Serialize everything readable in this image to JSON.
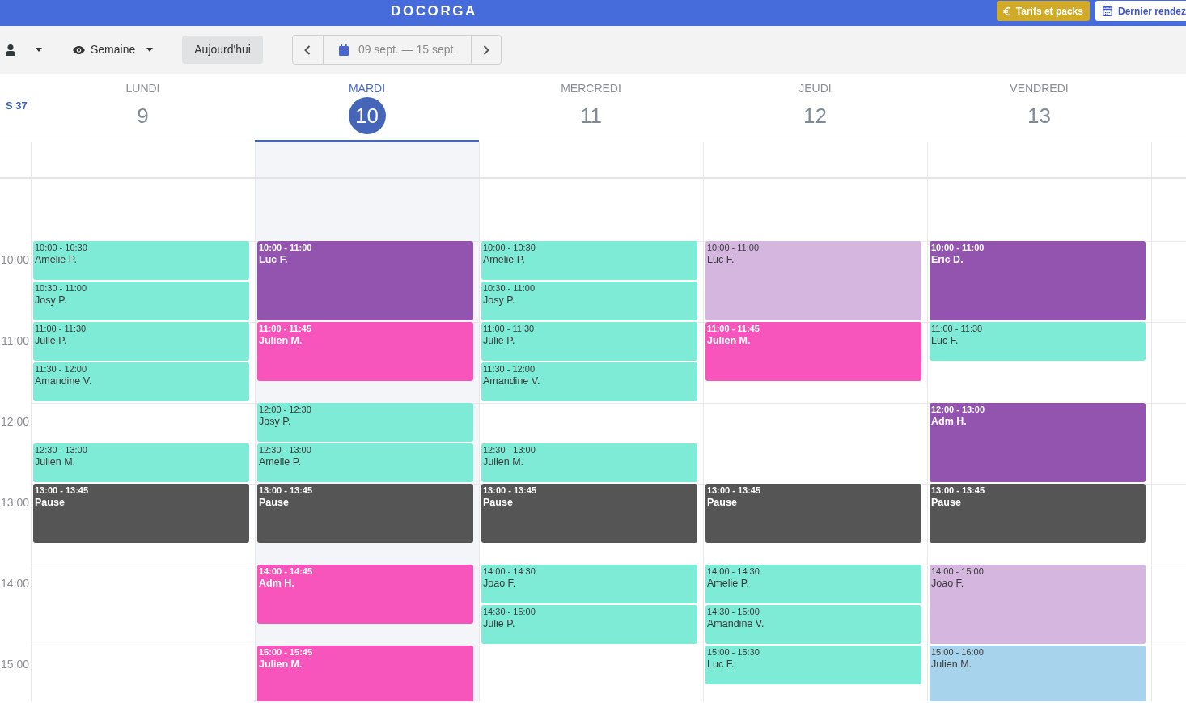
{
  "top_bar": {
    "logo": "DOCORGA",
    "buttons": [
      {
        "kind": "accent",
        "label": "Tarifs et packs"
      },
      {
        "kind": "outline",
        "label": "Dernier rendez"
      }
    ]
  },
  "toolbar": {
    "view": "Semaine",
    "today_button": "Aujourd'hui",
    "date_range": "09 sept. — 15 sept."
  },
  "week_label": "S 37",
  "hours": [
    "10:00",
    "11:00",
    "12:00",
    "13:00",
    "14:00",
    "15:00"
  ],
  "days": [
    {
      "name": "LUNDI",
      "number": "9",
      "selected": false,
      "events": [
        {
          "time": "10:00 - 10:30",
          "title": "Amelie P.",
          "color": "#7eebd6"
        },
        {
          "time": "10:30 - 11:00",
          "title": "Josy P.",
          "color": "#7eebd6"
        },
        {
          "time": "11:00 - 11:30",
          "title": "Julie P.",
          "color": "#7eebd6"
        },
        {
          "time": "11:30 - 12:00",
          "title": "Amandine V.",
          "color": "#7eebd6"
        },
        {
          "time": "12:30 - 13:00",
          "title": "Julien M.",
          "color": "#7eebd6"
        },
        {
          "time": "13:00 - 13:45",
          "title": "Pause",
          "color": "#555555"
        }
      ]
    },
    {
      "name": "MARDI",
      "number": "10",
      "selected": true,
      "events": [
        {
          "time": "10:00 - 11:00",
          "title": "Luc F.",
          "color": "#9354b0"
        },
        {
          "time": "11:00 - 11:45",
          "title": "Julien M.",
          "color": "#f755bb"
        },
        {
          "time": "12:00 - 12:30",
          "title": "Josy P.",
          "color": "#7eebd6"
        },
        {
          "time": "12:30 - 13:00",
          "title": "Amelie P.",
          "color": "#7eebd6"
        },
        {
          "time": "13:00 - 13:45",
          "title": "Pause",
          "color": "#555555"
        },
        {
          "time": "14:00 - 14:45",
          "title": "Adm H.",
          "color": "#f755bb"
        },
        {
          "time": "15:00 - 15:45",
          "title": "Julien M.",
          "color": "#f755bb"
        }
      ]
    },
    {
      "name": "MERCREDI",
      "number": "11",
      "selected": false,
      "events": [
        {
          "time": "10:00 - 10:30",
          "title": "Amelie P.",
          "color": "#7eebd6"
        },
        {
          "time": "10:30 - 11:00",
          "title": "Josy P.",
          "color": "#7eebd6"
        },
        {
          "time": "11:00 - 11:30",
          "title": "Julie P.",
          "color": "#7eebd6"
        },
        {
          "time": "11:30 - 12:00",
          "title": "Amandine V.",
          "color": "#7eebd6"
        },
        {
          "time": "12:30 - 13:00",
          "title": "Julien M.",
          "color": "#7eebd6"
        },
        {
          "time": "13:00 - 13:45",
          "title": "Pause",
          "color": "#555555"
        },
        {
          "time": "14:00 - 14:30",
          "title": "Joao F.",
          "color": "#7eebd6"
        },
        {
          "time": "14:30 - 15:00",
          "title": "Julie P.",
          "color": "#7eebd6"
        }
      ]
    },
    {
      "name": "JEUDI",
      "number": "12",
      "selected": false,
      "events": [
        {
          "time": "10:00 - 11:00",
          "title": "Luc F.",
          "color": "#d4b6df"
        },
        {
          "time": "11:00 - 11:45",
          "title": "Julien M.",
          "color": "#f755bb"
        },
        {
          "time": "13:00 - 13:45",
          "title": "Pause",
          "color": "#555555"
        },
        {
          "time": "14:00 - 14:30",
          "title": "Amelie P.",
          "color": "#7eebd6"
        },
        {
          "time": "14:30 - 15:00",
          "title": "Amandine V.",
          "color": "#7eebd6"
        },
        {
          "time": "15:00 - 15:30",
          "title": "Luc F.",
          "color": "#7eebd6"
        }
      ]
    },
    {
      "name": "VENDREDI",
      "number": "13",
      "selected": false,
      "events": [
        {
          "time": "10:00 - 11:00",
          "title": "Eric D.",
          "color": "#9354b0"
        },
        {
          "time": "11:00 - 11:30",
          "title": "Luc F.",
          "color": "#7eebd6"
        },
        {
          "time": "12:00 - 13:00",
          "title": "Adm H.",
          "color": "#9354b0"
        },
        {
          "time": "13:00 - 13:45",
          "title": "Pause",
          "color": "#555555"
        },
        {
          "time": "14:00 - 15:00",
          "title": "Joao F.",
          "color": "#d4b6df"
        },
        {
          "time": "15:00 - 16:00",
          "title": "Julien M.",
          "color": "#a7d3ec"
        }
      ]
    }
  ]
}
